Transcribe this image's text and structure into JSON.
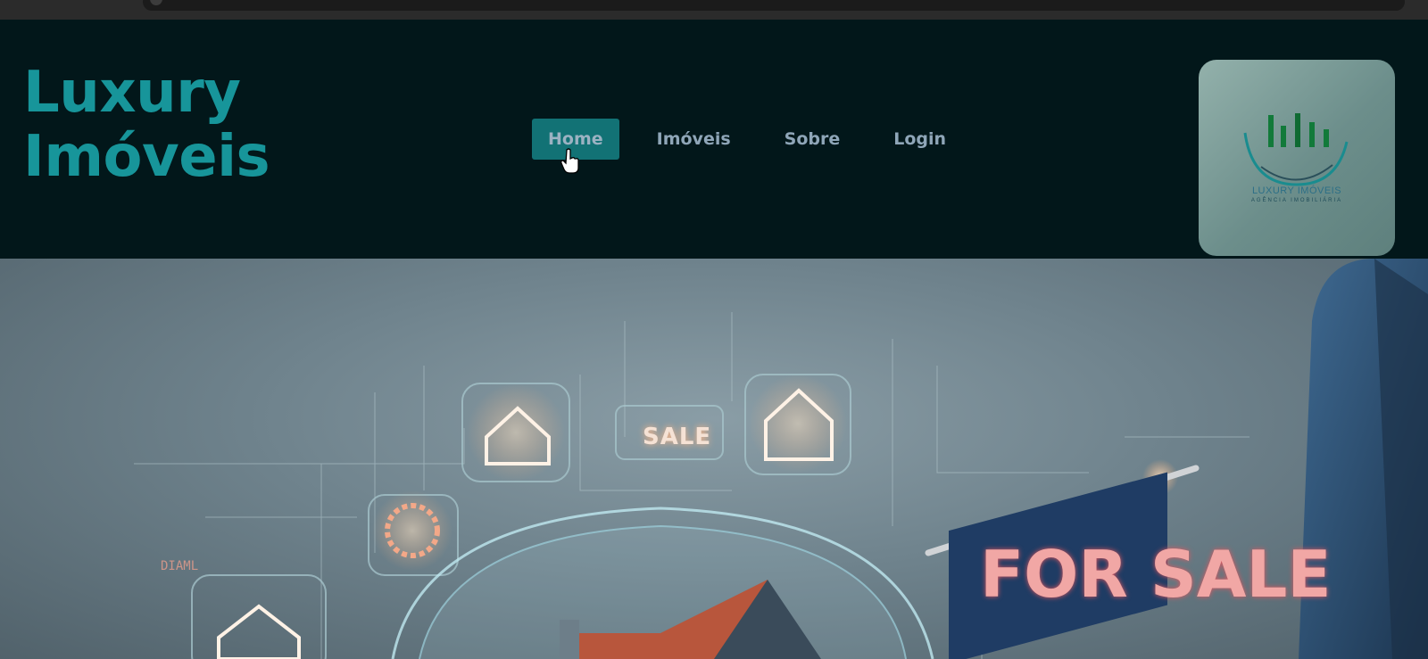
{
  "site": {
    "brand_line1": "Luxury",
    "brand_line2": "Imóveis"
  },
  "nav": {
    "items": [
      {
        "label": "Home",
        "active": true
      },
      {
        "label": "Imóveis",
        "active": false
      },
      {
        "label": "Sobre",
        "active": false
      },
      {
        "label": "Login",
        "active": false
      }
    ]
  },
  "logo": {
    "name": "LUXURY IMÓVEIS",
    "subtitle": "AGÊNCIA IMOBILIÁRIA"
  },
  "hero": {
    "sign_small": "SALE",
    "sign_large": "FOR SALE",
    "label_diamond": "DIAML"
  },
  "colors": {
    "brand": "#17959a",
    "nav_active_bg": "#127275",
    "nav_text": "#8fa6b8",
    "header_bg": "#02171a"
  }
}
